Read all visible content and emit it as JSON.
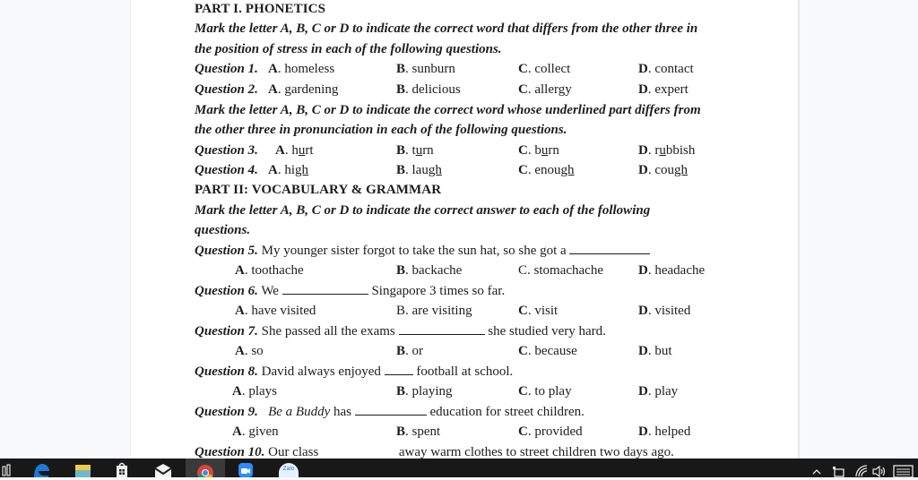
{
  "document": {
    "part1_title": "PART I. PHONETICS",
    "instr1_line1": "Mark the letter A, B, C or D to indicate the correct word that differs from the other three in",
    "instr1_line2": "the position of stress in each of the following questions.",
    "instr2_line1": "Mark the letter A, B, C or D to indicate the correct word whose underlined part differs from",
    "instr2_line2": "the other three in pronunciation in each of the following questions.",
    "part2_title": "PART II: VOCABULARY & GRAMMAR",
    "instr3_line1": "Mark the letter A, B, C or D to indicate the correct answer to each of the following",
    "instr3_line2": "questions.",
    "questions": [
      {
        "label": "Question 1.",
        "options": [
          {
            "letter": "A",
            "text": "homeless"
          },
          {
            "letter": "B",
            "text": "sunburn"
          },
          {
            "letter": "C",
            "text": "collect"
          },
          {
            "letter": "D",
            "text": "contact"
          }
        ]
      },
      {
        "label": "Question 2.",
        "options": [
          {
            "letter": "A",
            "text": "gardening"
          },
          {
            "letter": "B",
            "text": "delicious"
          },
          {
            "letter": "C",
            "text": "allergy"
          },
          {
            "letter": "D",
            "text": "expert"
          }
        ]
      },
      {
        "label": "Question 3.",
        "options": [
          {
            "letter": "A",
            "pre": "h",
            "under": "u",
            "post": "rt"
          },
          {
            "letter": "B",
            "pre": "t",
            "under": "u",
            "post": "rn"
          },
          {
            "letter": "C",
            "pre": "b",
            "under": "u",
            "post": "rn"
          },
          {
            "letter": "D",
            "pre": "r",
            "under": "u",
            "post": "bbish"
          }
        ]
      },
      {
        "label": "Question 4.",
        "options": [
          {
            "letter": "A",
            "pre": "hi",
            "under": "gh",
            "post": ""
          },
          {
            "letter": "B",
            "pre": "lau",
            "under": "gh",
            "post": ""
          },
          {
            "letter": "C",
            "pre": "enou",
            "under": "gh",
            "post": ""
          },
          {
            "letter": "D",
            "pre": "cou",
            "under": "gh",
            "post": ""
          }
        ]
      },
      {
        "label": "Question 5.",
        "stem_before": "My younger sister forgot to take the sun hat, so she got a",
        "stem_after": "",
        "options": [
          {
            "letter": "A",
            "text": "toothache"
          },
          {
            "letter": "B",
            "text": "backache"
          },
          {
            "letter": "C",
            "text": "stomachache"
          },
          {
            "letter": "D",
            "text": "headache"
          }
        ]
      },
      {
        "label": "Question 6.",
        "stem_before": "We",
        "stem_after": "Singapore 3 times so far.",
        "options": [
          {
            "letter": "A",
            "text": "have visited"
          },
          {
            "letter": "B",
            "text": "are visiting"
          },
          {
            "letter": "C",
            "text": "visit"
          },
          {
            "letter": "D",
            "text": "visited"
          }
        ]
      },
      {
        "label": "Question 7.",
        "stem_before": "She passed all the exams",
        "stem_after": "she studied very hard.",
        "options": [
          {
            "letter": "A",
            "text": "so"
          },
          {
            "letter": "B",
            "text": "or"
          },
          {
            "letter": "C",
            "text": "because"
          },
          {
            "letter": "D",
            "text": "but"
          }
        ]
      },
      {
        "label": "Question 8.",
        "stem_before": "David always enjoyed",
        "stem_after": "football at school.",
        "options": [
          {
            "letter": "A",
            "text": "plays"
          },
          {
            "letter": "B",
            "text": "playing"
          },
          {
            "letter": "C",
            "text": "to play"
          },
          {
            "letter": "D",
            "text": "play"
          }
        ]
      },
      {
        "label": "Question 9.",
        "stem_italic": "Be a Buddy",
        "stem_before": "has",
        "stem_after": "education for street children.",
        "options": [
          {
            "letter": "A",
            "text": "given"
          },
          {
            "letter": "B",
            "text": "spent"
          },
          {
            "letter": "C",
            "text": "provided"
          },
          {
            "letter": "D",
            "text": "helped"
          }
        ]
      },
      {
        "label": "Question 10.",
        "stem_before": "Our class",
        "stem_after": "away warm clothes to street children two days ago."
      }
    ]
  },
  "taskbar": {
    "icons": [
      "task-view",
      "edge",
      "file-explorer",
      "microsoft-store",
      "mail",
      "chrome",
      "zoom",
      "zalo"
    ],
    "zalo_label": "Zalo",
    "tray": [
      "show-hidden-icons",
      "network-device",
      "wifi",
      "volume",
      "keyboard"
    ]
  }
}
